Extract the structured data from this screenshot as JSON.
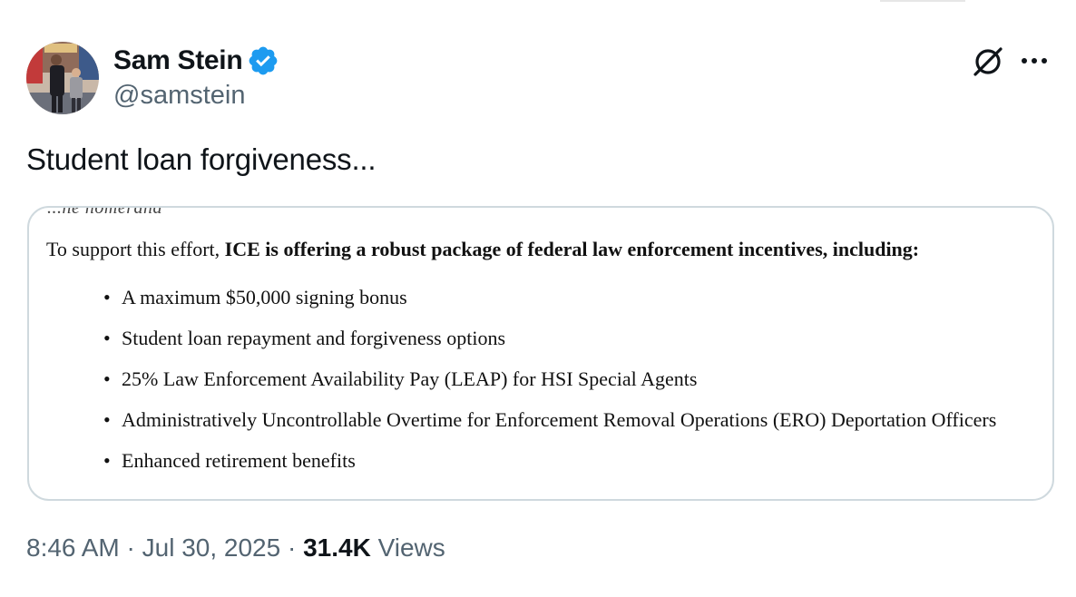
{
  "author": {
    "display_name": "Sam Stein",
    "handle": "@samstein",
    "verified": true,
    "avatar_icon": "user-avatar-photo"
  },
  "actions": {
    "grok_icon": "grok-slash-circle-icon",
    "more_icon": "more-dots-icon"
  },
  "tweet": {
    "text": "Student loan forgiveness..."
  },
  "media": {
    "cut_line": "...ne nomerand",
    "intro_prefix": "To support this effort, ",
    "intro_bold": "ICE is offering a robust package of federal law enforcement incentives, including:",
    "bullets": [
      "A maximum $50,000 signing bonus",
      "Student loan repayment and forgiveness options",
      "25% Law Enforcement Availability Pay (LEAP) for HSI Special Agents",
      "Administratively Uncontrollable Overtime for Enforcement Removal Operations (ERO) Deportation Officers",
      "Enhanced retirement benefits"
    ]
  },
  "meta": {
    "time": "8:46 AM",
    "sep1": " · ",
    "date": "Jul 30, 2025",
    "sep2": " · ",
    "views_count": "31.4K",
    "views_label": " Views"
  },
  "colors": {
    "verified_badge": "#1d9bf0",
    "secondary_text": "#536471",
    "border": "#cfd9de"
  }
}
